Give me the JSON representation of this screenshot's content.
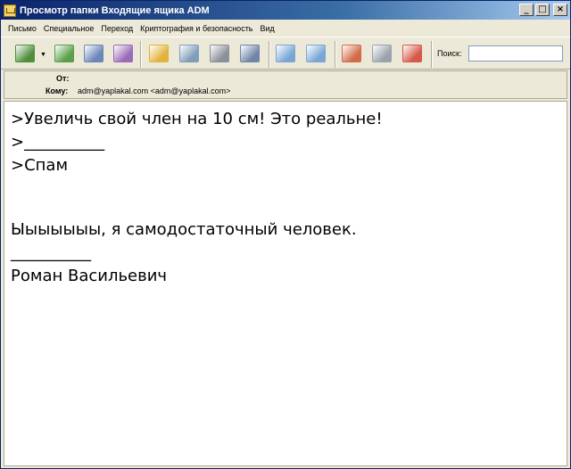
{
  "window": {
    "title": "Просмотр папки Входящие ящика ADM",
    "minimize": "_",
    "maximize": "□",
    "close": "×"
  },
  "menu": [
    {
      "label": "Письмо"
    },
    {
      "label": "Специальное"
    },
    {
      "label": "Переход"
    },
    {
      "label": "Криптография и безопасность"
    },
    {
      "label": "Вид"
    }
  ],
  "toolbar": {
    "buttons": [
      {
        "name": "get-mail-icon",
        "color": "#4f8f3a"
      },
      {
        "name": "forward-mail-icon",
        "color": "#5aa04a"
      },
      {
        "name": "reply-icon",
        "color": "#6b86b8"
      },
      {
        "name": "reply-all-icon",
        "color": "#9a6bb8"
      },
      {
        "name": "address-book-icon",
        "color": "#e2b23a"
      },
      {
        "name": "search-mail-icon",
        "color": "#7f9db9"
      },
      {
        "name": "print-icon",
        "color": "#8a8f99"
      },
      {
        "name": "save-icon",
        "color": "#6f86a8"
      },
      {
        "name": "move-up-icon",
        "color": "#7aa6d6"
      },
      {
        "name": "move-down-icon",
        "color": "#7aa6d6"
      },
      {
        "name": "spam-icon",
        "color": "#d36b4a"
      },
      {
        "name": "trash-icon",
        "color": "#9aa3ad"
      },
      {
        "name": "delete-mail-icon",
        "color": "#d6584a"
      }
    ],
    "search_label": "Поиск:",
    "search_value": ""
  },
  "header": {
    "from_label": "От:",
    "from_value": "",
    "to_label": "Кому:",
    "to_value": "adm@yaplakal.com <adm@yaplakal.com>"
  },
  "message": {
    "line1": ">Увеличь свой член на 10 см! Это реальне!",
    "line2": ">__________",
    "line3": ">Спам",
    "line4": "Ыыыыыыы, я самодостаточный человек.",
    "line5": "__________",
    "line6": "Роман Васильевич"
  }
}
